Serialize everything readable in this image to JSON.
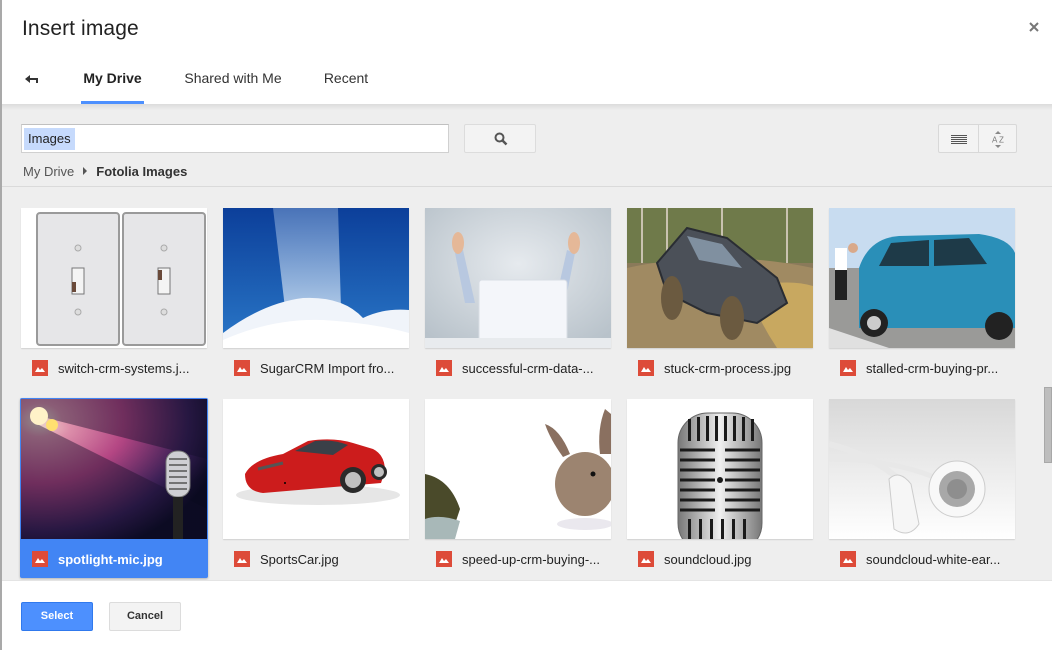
{
  "dialog": {
    "title": "Insert image",
    "close_icon": "close-icon"
  },
  "tabs": {
    "back_icon": "back-arrow-icon",
    "items": [
      {
        "label": "My Drive",
        "active": true
      },
      {
        "label": "Shared with Me",
        "active": false
      },
      {
        "label": "Recent",
        "active": false
      }
    ]
  },
  "search": {
    "value": "Images",
    "button_icon": "search-icon"
  },
  "view_controls": {
    "list_view_icon": "list-view-icon",
    "sort_icon": "sort-az-icon"
  },
  "breadcrumb": {
    "items": [
      "My Drive",
      "Fotolia Images"
    ]
  },
  "files": [
    {
      "name": "switch-crm-systems.j...",
      "selected": false
    },
    {
      "name": "SugarCRM Import fro...",
      "selected": false
    },
    {
      "name": "successful-crm-data-...",
      "selected": false
    },
    {
      "name": "stuck-crm-process.jpg",
      "selected": false
    },
    {
      "name": "stalled-crm-buying-pr...",
      "selected": false
    },
    {
      "name": "spotlight-mic.jpg",
      "selected": true
    },
    {
      "name": "SportsCar.jpg",
      "selected": false
    },
    {
      "name": "speed-up-crm-buying-...",
      "selected": false
    },
    {
      "name": "soundcloud.jpg",
      "selected": false
    },
    {
      "name": "soundcloud-white-ear...",
      "selected": false
    }
  ],
  "colors": {
    "accent": "#4285f4",
    "tab_underline": "#4d90fe",
    "file_icon": "#dd4b39"
  },
  "footer": {
    "select_label": "Select",
    "cancel_label": "Cancel"
  }
}
